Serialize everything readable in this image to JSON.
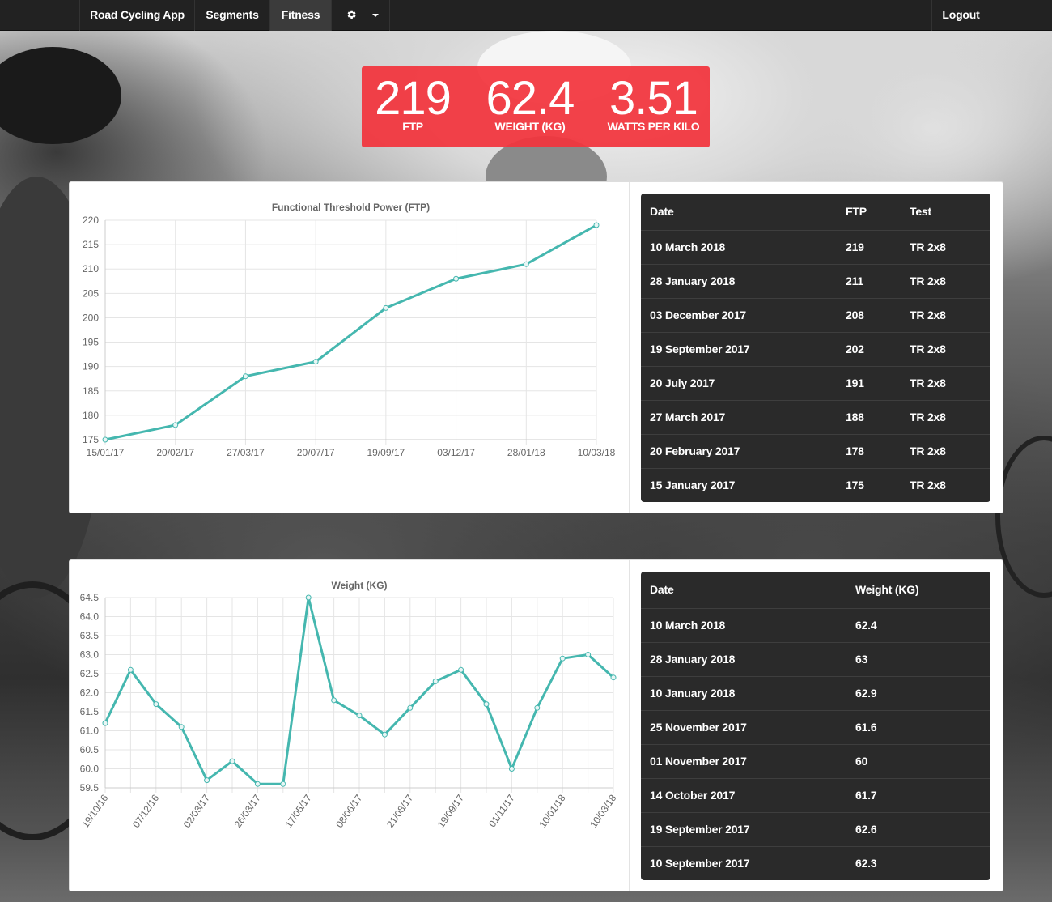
{
  "nav": {
    "brand": "Road Cycling App",
    "segments": "Segments",
    "fitness": "Fitness",
    "settings_icon": "gear-icon",
    "dropdown_icon": "caret-down-icon",
    "logout": "Logout"
  },
  "stats": {
    "ftp_value": "219",
    "ftp_label": "FTP",
    "weight_value": "62.4",
    "weight_label": "WEIGHT (KG)",
    "wpk_value": "3.51",
    "wpk_label": "WATTS PER KILO",
    "accent_color": "#f2343c"
  },
  "ftp_table": {
    "headers": [
      "Date",
      "FTP",
      "Test"
    ],
    "rows": [
      [
        "10 March 2018",
        "219",
        "TR 2x8"
      ],
      [
        "28 January 2018",
        "211",
        "TR 2x8"
      ],
      [
        "03 December 2017",
        "208",
        "TR 2x8"
      ],
      [
        "19 September 2017",
        "202",
        "TR 2x8"
      ],
      [
        "20 July 2017",
        "191",
        "TR 2x8"
      ],
      [
        "27 March 2017",
        "188",
        "TR 2x8"
      ],
      [
        "20 February 2017",
        "178",
        "TR 2x8"
      ],
      [
        "15 January 2017",
        "175",
        "TR 2x8"
      ]
    ]
  },
  "weight_table": {
    "headers": [
      "Date",
      "Weight (KG)"
    ],
    "rows": [
      [
        "10 March 2018",
        "62.4"
      ],
      [
        "28 January 2018",
        "63"
      ],
      [
        "10 January 2018",
        "62.9"
      ],
      [
        "25 November 2017",
        "61.6"
      ],
      [
        "01 November 2017",
        "60"
      ],
      [
        "14 October 2017",
        "61.7"
      ],
      [
        "19 September 2017",
        "62.6"
      ],
      [
        "10 September 2017",
        "62.3"
      ]
    ]
  },
  "chart_data": [
    {
      "type": "line",
      "title": "Functional Threshold Power (FTP)",
      "xlabel": "",
      "ylabel": "",
      "x": [
        "15/01/17",
        "20/02/17",
        "27/03/17",
        "20/07/17",
        "19/09/17",
        "03/12/17",
        "28/01/18",
        "10/03/18"
      ],
      "series": [
        {
          "values": [
            175,
            178,
            188,
            191,
            202,
            208,
            211,
            219
          ]
        }
      ],
      "ylim": [
        175,
        220
      ],
      "yticks": [
        "220",
        "215",
        "210",
        "205",
        "200",
        "195",
        "190",
        "185",
        "180",
        "175"
      ],
      "grid": true,
      "line_color": "#45b7af"
    },
    {
      "type": "line",
      "title": "Weight (KG)",
      "xlabel": "",
      "ylabel": "",
      "x": [
        "19/10/16",
        "",
        "07/12/16",
        "",
        "02/03/17",
        "",
        "26/03/17",
        "",
        "17/05/17",
        "",
        "08/06/17",
        "",
        "21/08/17",
        "",
        "19/09/17",
        "",
        "01/11/17",
        "",
        "10/01/18",
        "",
        "10/03/18"
      ],
      "series": [
        {
          "values": [
            61.2,
            62.6,
            61.7,
            61.1,
            59.7,
            60.2,
            59.6,
            59.6,
            64.5,
            61.8,
            61.4,
            60.9,
            61.6,
            62.3,
            62.6,
            61.7,
            60.0,
            61.6,
            62.9,
            63.0,
            62.4
          ]
        }
      ],
      "ylim": [
        59.5,
        64.5
      ],
      "yticks": [
        "64.5",
        "64.0",
        "63.5",
        "63.0",
        "62.5",
        "62.0",
        "61.5",
        "61.0",
        "60.5",
        "60.0",
        "59.5"
      ],
      "grid": true,
      "line_color": "#45b7af"
    }
  ]
}
